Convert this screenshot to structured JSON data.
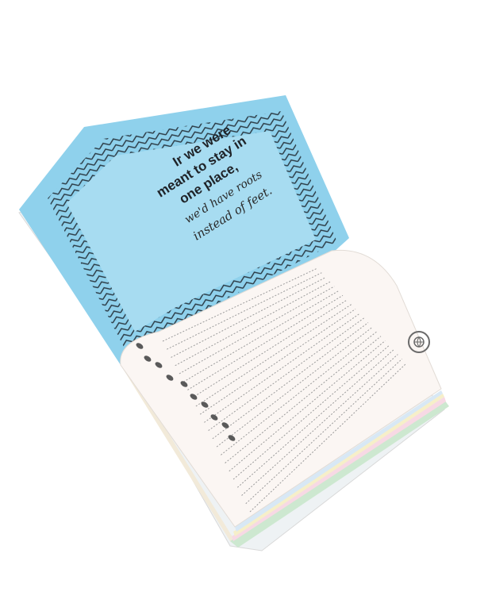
{
  "quote": {
    "line1": "Ir we were",
    "line2": "meant to stay in",
    "line3": "one place,",
    "line4": "we'd have roots",
    "line5": "instead of feet."
  },
  "colors": {
    "background": "#ffffff",
    "left_page": "#8fd1ec",
    "quote_panel": "#a7dcf1",
    "chevron": "#2b3a44",
    "right_page": "#fbf6f3",
    "ruled_line": "#9b9b9b",
    "footprints": "#5a5a5a",
    "page_edges": "#f2ead9"
  },
  "icons": {
    "stamp": "globe-stamp-icon",
    "footprints": "footprints-icon"
  }
}
